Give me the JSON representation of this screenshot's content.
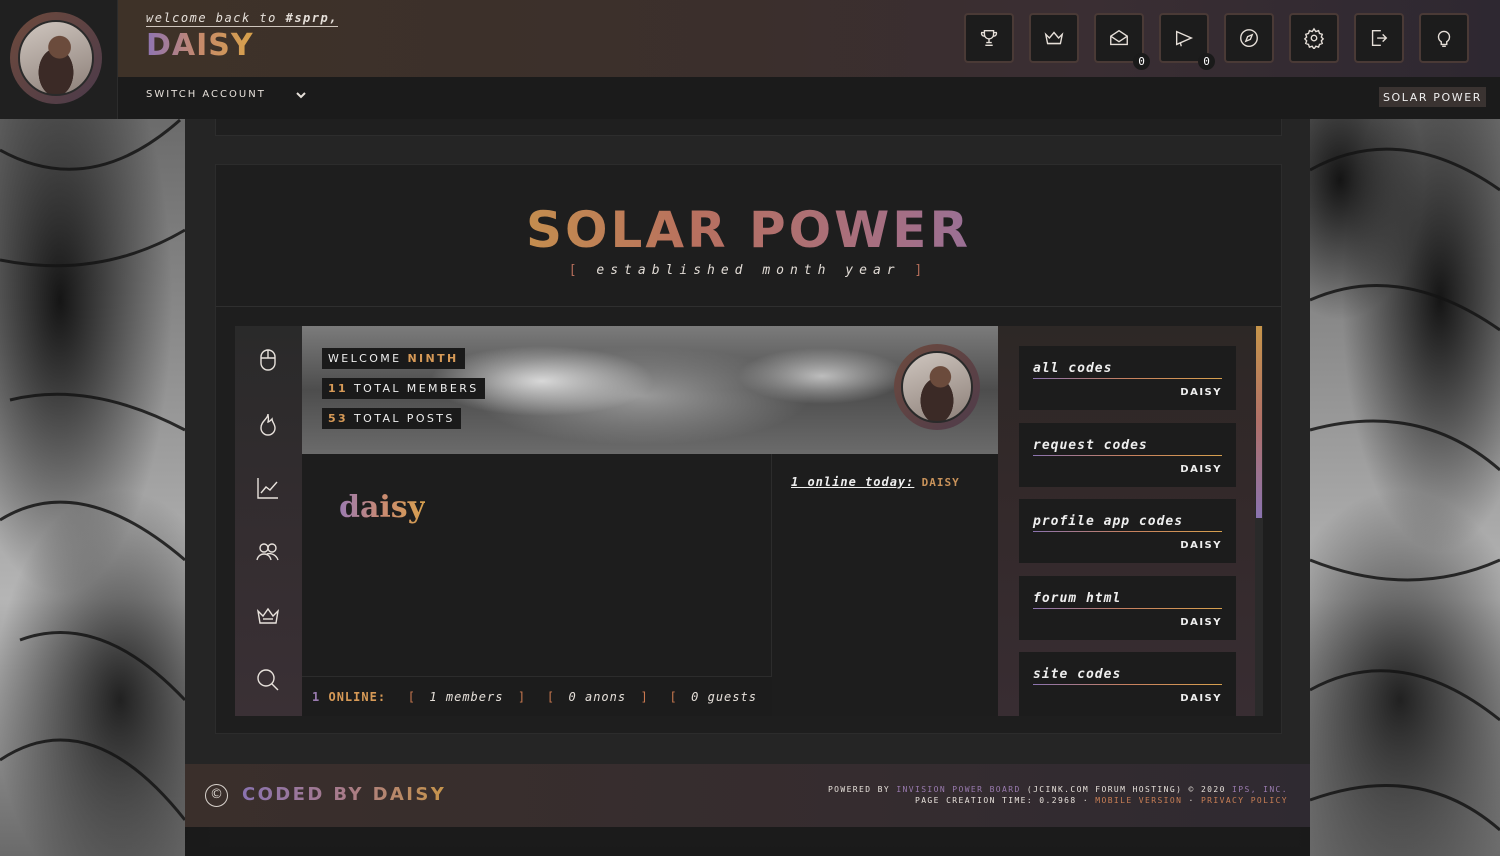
{
  "header": {
    "welcome_prefix": "welcome back to",
    "welcome_site": "#sprp,",
    "username": "DAISY",
    "switch_account": "SWITCH ACCOUNT",
    "site_tag": "SOLAR POWER",
    "icons": [
      {
        "name": "trophy-icon"
      },
      {
        "name": "crown-icon"
      },
      {
        "name": "mail-icon",
        "badge": "0"
      },
      {
        "name": "megaphone-icon",
        "badge": "0"
      },
      {
        "name": "compass-icon"
      },
      {
        "name": "gear-icon"
      },
      {
        "name": "logout-icon"
      },
      {
        "name": "lightbulb-icon"
      }
    ]
  },
  "board": {
    "title": "SOLAR POWER",
    "established_open": "[",
    "established": "established month year",
    "established_close": "]",
    "sidebar_icons": [
      "mouse-icon",
      "flame-icon",
      "chart-icon",
      "users-icon",
      "crown-icon",
      "search-icon"
    ],
    "stats": {
      "welcome_label": "WELCOME",
      "welcome_value": "NINTH",
      "members_value": "11",
      "members_label": "TOTAL MEMBERS",
      "posts_value": "53",
      "posts_label": "TOTAL POSTS"
    },
    "feature_name": "daisy",
    "online_today_label": "1 online today:",
    "online_today_user": "DAISY",
    "online": {
      "count": "1",
      "label": "ONLINE:",
      "members": "1 members",
      "anons": "0 anons",
      "guests": "0 guests"
    },
    "codes": [
      {
        "title": "all codes",
        "author": "DAISY"
      },
      {
        "title": "request codes",
        "author": "DAISY"
      },
      {
        "title": "profile app codes",
        "author": "DAISY"
      },
      {
        "title": "forum html",
        "author": "DAISY"
      },
      {
        "title": "site codes",
        "author": "DAISY"
      }
    ]
  },
  "footer": {
    "copyright_symbol": "©",
    "coded_by": "CODED BY DAISY",
    "powered_by": "POWERED BY",
    "ipb": "INVISION POWER BOARD",
    "jcink": "(JCINK.COM FORUM HOSTING)",
    "copyright_year": "© 2020",
    "ips": "IPS, INC.",
    "page_creation": "PAGE CREATION TIME: 0.2968",
    "separator": "·",
    "mobile": "MOBILE VERSION",
    "privacy": "PRIVACY POLICY"
  },
  "colors": {
    "gold": "#d79a57",
    "rose": "#b8705f",
    "lavender": "#8a73b0",
    "panel_dark": "#1c1c1c"
  }
}
